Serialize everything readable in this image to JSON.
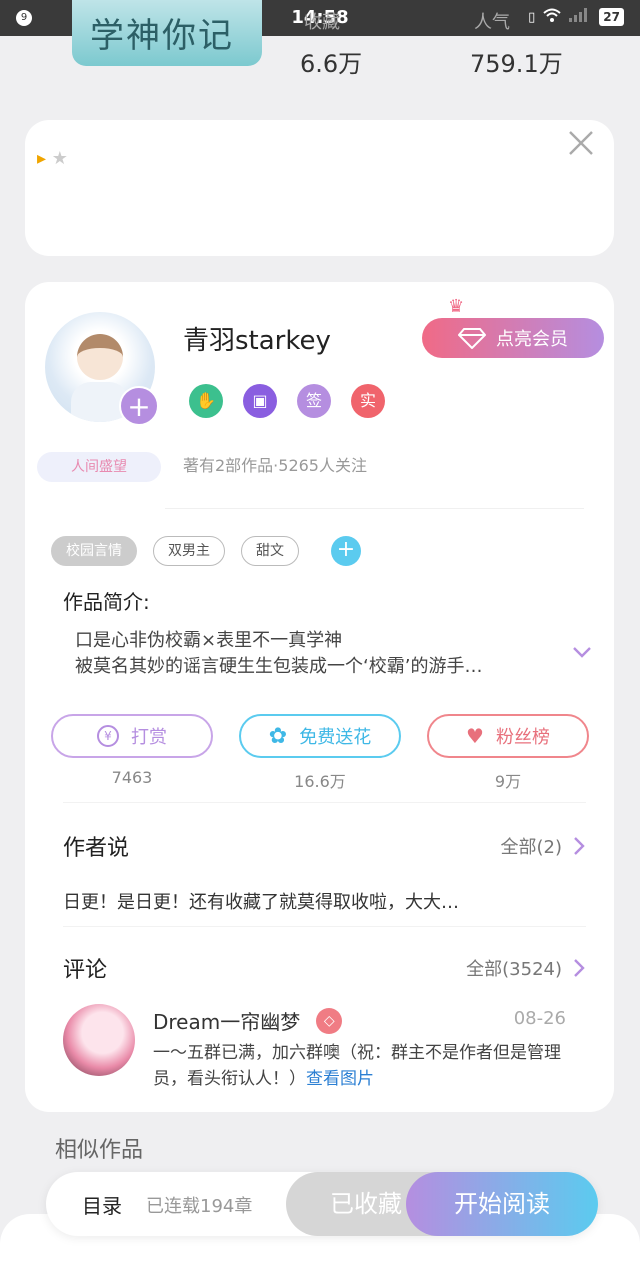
{
  "status_bar": {
    "notif_count": "9",
    "time": "14:58",
    "battery": "27"
  },
  "book": {
    "cover_title": "学神你记",
    "stat1_label": "收藏",
    "stat1_value": "6.6万",
    "stat2_label": "人气",
    "stat2_value": "759.1万"
  },
  "ad": {
    "stars": "★"
  },
  "author": {
    "name": "青羽starkey",
    "title_badge": "人间盛望",
    "subtitle": "著有2部作品·5265人关注",
    "vip_button": "点亮会员",
    "medals": [
      {
        "label": "",
        "icon": "handshake-medal"
      },
      {
        "label": "",
        "icon": "book-medal"
      },
      {
        "label": "签"
      },
      {
        "label": "实"
      }
    ]
  },
  "tags": [
    "校园言情",
    "双男主",
    "甜文"
  ],
  "intro": {
    "label": "作品简介:",
    "line1": "口是心非伪校霸×表里不一真学神",
    "line2": "被莫名其妙的谣言硬生生包装成一个‘校霸’的游手…"
  },
  "actions": [
    {
      "label": "打赏",
      "count": "7463",
      "icon": "¥"
    },
    {
      "label": "免费送花",
      "count": "16.6万",
      "icon": "✿"
    },
    {
      "label": "粉丝榜",
      "count": "9万",
      "icon": "♥"
    }
  ],
  "author_says": {
    "title": "作者说",
    "more": "全部(2)",
    "text": "日更！是日更！还有收藏了就莫得取收啦，大大…"
  },
  "comments": {
    "title": "评论",
    "more": "全部(3524)",
    "item": {
      "name": "Dream一帘幽梦",
      "date": "08-26",
      "text": "一～五群已满，加六群噢（祝：群主不是作者但是管理员，看头衔认人！）",
      "link": "查看图片"
    }
  },
  "similar": {
    "title": "相似作品"
  },
  "bottom": {
    "toc": "目录",
    "serial": "已连载194章",
    "saved": "已收藏",
    "read": "开始阅读"
  }
}
